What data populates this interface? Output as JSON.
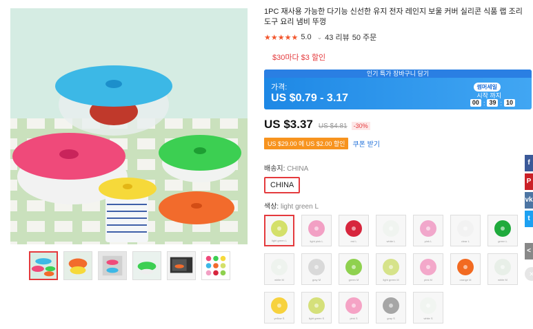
{
  "product": {
    "title": "1PC 재사용 가능한 다기능 신선한 유지 전자 레인지 보울 커버 실리콘 식품 랩 조리 도구 요리 냄비 뚜껑",
    "rating": "5.0",
    "stars": "★★★★★",
    "reviews": "43 리뷰",
    "orders": "50 주문",
    "promo": "$30마다 $3 할인"
  },
  "banner": {
    "header": "인기 특가 장바구니 담기",
    "price_label": "가격:",
    "price_range": "US $0.79 - 3.17",
    "badge": "썸머세일",
    "start_text": "시작 까지",
    "countdown": [
      "00",
      "39",
      "10"
    ]
  },
  "pricing": {
    "price": "US $3.37",
    "original": "US $4.81",
    "discount": "-30%"
  },
  "coupon": {
    "text": "US $29.00 에 US $2.00 할인",
    "link": "쿠폰 받기"
  },
  "shipping": {
    "label": "배송지:",
    "value": "CHINA",
    "button": "CHINA"
  },
  "color": {
    "label": "색상:",
    "selected": "light green L",
    "swatches": [
      {
        "color": "#d4e06a",
        "caption": "light green L"
      },
      {
        "color": "#f2a0c4",
        "caption": "light pink L"
      },
      {
        "color": "#d7263d",
        "caption": "red L"
      },
      {
        "color": "#f0f4f0",
        "caption": "white L"
      },
      {
        "color": "#f1a7cb",
        "caption": "pink L"
      },
      {
        "color": "#f2f2f2",
        "caption": "clear L"
      },
      {
        "color": "#1faa3c",
        "caption": "green L"
      },
      {
        "color": "#eef3ee",
        "caption": "white M"
      },
      {
        "color": "#d9d9d9",
        "caption": "gray M"
      },
      {
        "color": "#8fd14f",
        "caption": "green M"
      },
      {
        "color": "#d6e38a",
        "caption": "light green M"
      },
      {
        "color": "#f3a8ca",
        "caption": "pink M"
      },
      {
        "color": "#f26a21",
        "caption": "orange M"
      },
      {
        "color": "#e8efe8",
        "caption": "white M"
      },
      {
        "color": "#f7d23e",
        "caption": "yellow S"
      },
      {
        "color": "#d5e07a",
        "caption": "light green S"
      },
      {
        "color": "#f5a3c5",
        "caption": "pink S"
      },
      {
        "color": "#a6a6a6",
        "caption": "gray S"
      },
      {
        "color": "#f1f5f1",
        "caption": "white S"
      }
    ]
  },
  "share": {
    "facebook": "f",
    "pinterest": "P",
    "vk": "vk",
    "twitter": "t",
    "more": "<"
  }
}
